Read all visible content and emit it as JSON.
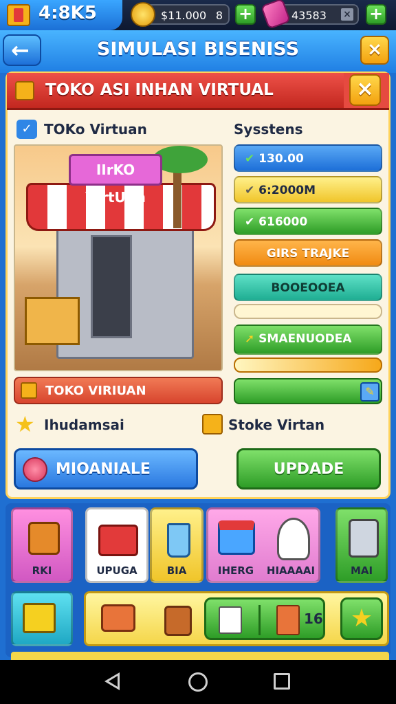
{
  "status": {
    "time": "4:8K5"
  },
  "currency": {
    "coins": "$11.000",
    "coins_extra": "8",
    "gems": "43583"
  },
  "header": {
    "title": "SIMULASI BISENISS"
  },
  "ribbon": {
    "title": "TOKO ASI INHAN VIRTUAL"
  },
  "shop": {
    "title": "TOKo Virtuan",
    "sign": "IIrKO VIrtUAn",
    "name_bar": "TOKO VIRIUAN"
  },
  "stats": {
    "title": "Sysstens",
    "bars": [
      {
        "label": "130.00",
        "color": "#2f86e6"
      },
      {
        "label": "6:2000M",
        "color": "#f7d94a"
      },
      {
        "label": "616000",
        "color": "#4cbf3c"
      },
      {
        "label": "GIRS TRAJKE",
        "color": "#f59a24"
      },
      {
        "label": "BOOEOOEA",
        "color": "#2cc2a6"
      },
      {
        "label": "SMAENUODEA",
        "color": "#4cbf3c"
      }
    ]
  },
  "info": {
    "left_label": "Ihudamsai",
    "right_label": "Stoke Virtan"
  },
  "buttons": {
    "manage": "MIOANIALE",
    "update": "UPDADE"
  },
  "tray": {
    "tiles": [
      {
        "label": "RKI",
        "icon": "bag-icon"
      },
      {
        "label": "UPUGA",
        "icon": "suitcase-icon"
      },
      {
        "label": "BIA",
        "icon": "cup-icon"
      },
      {
        "label": "IHERG",
        "icon": "cooler-icon"
      },
      {
        "label": "HIAAAAI",
        "icon": "mascot-icon"
      },
      {
        "label": "MAI",
        "icon": "tablet-icon"
      }
    ],
    "count": "16"
  }
}
